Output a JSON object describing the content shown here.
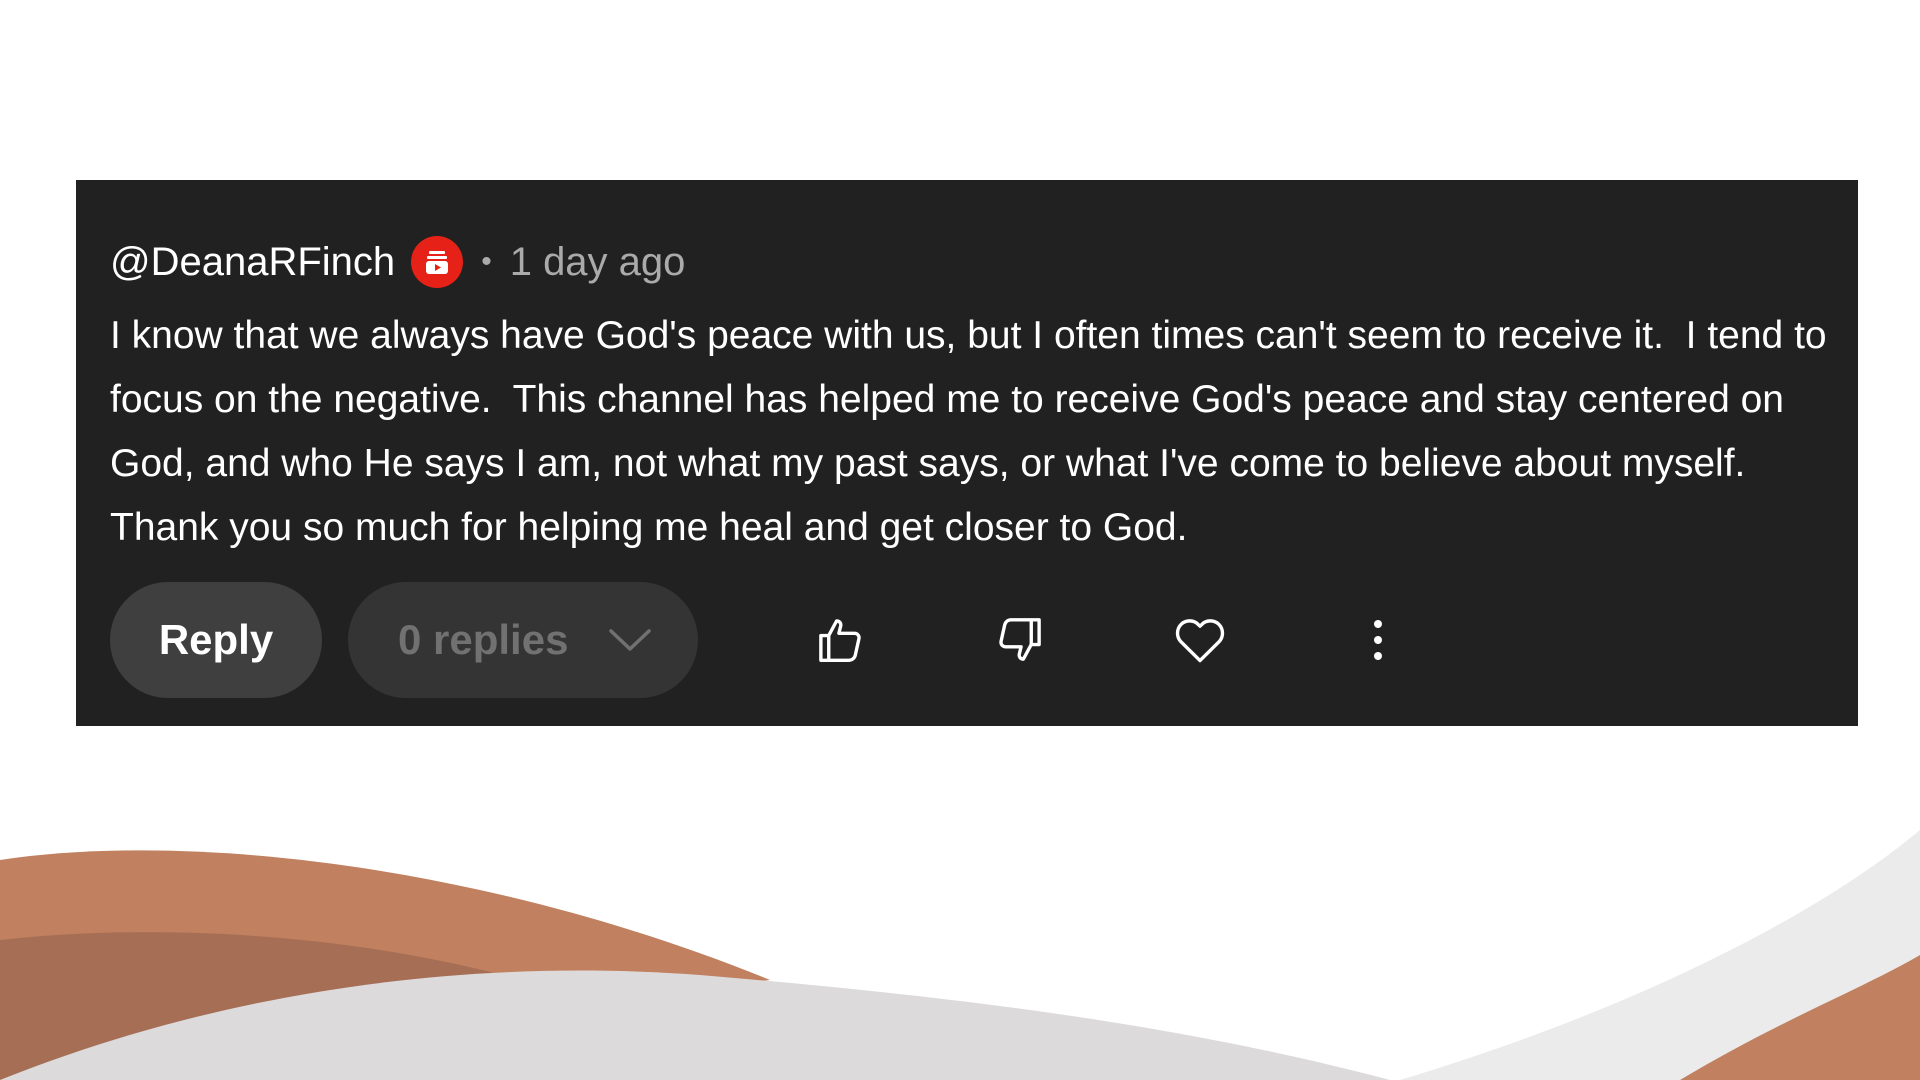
{
  "comment": {
    "author_handle": "@DeanaRFinch",
    "badge_icon": "creator-badge-icon",
    "separator": "•",
    "timestamp": "1 day ago",
    "text": "I know that we always have God's peace with us, but I often times can't seem to receive it.  I tend to focus on the negative.  This channel has helped me to receive God's peace and stay centered on God, and who He says I am, not what my past says, or what I've come to believe about myself.  Thank you so much for helping me heal and get closer to God."
  },
  "actions": {
    "reply_label": "Reply",
    "replies_label": "0 replies",
    "icons": [
      "thumbs-up-icon",
      "thumbs-down-icon",
      "heart-icon",
      "more-vertical-icon"
    ]
  },
  "colors": {
    "card_background": "#212121",
    "badge": "#e62117",
    "wave_brown": "#c1805f",
    "wave_dark_brown": "#a66f55",
    "wave_gray": "#dcdada"
  }
}
